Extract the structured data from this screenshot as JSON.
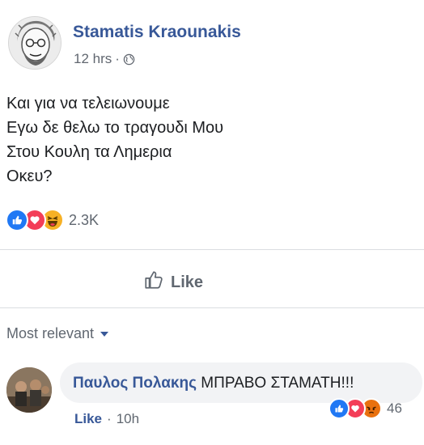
{
  "post": {
    "author": "Stamatis Kraounakis",
    "time": "12 hrs",
    "separator": "·",
    "privacy_icon": "globe-icon",
    "text_lines": [
      "Και για να τελειωνουμε",
      "Εγω δε θελω το τραγουδι Μου",
      "Στου Κουλη τα Λημερια",
      "Οκευ?"
    ],
    "reactions": {
      "icons": [
        "like-icon",
        "love-icon",
        "haha-icon"
      ],
      "count": "2.3K"
    },
    "actions": {
      "like_label": "Like"
    }
  },
  "comments_header": {
    "sort_label": "Most relevant"
  },
  "comment": {
    "author": "Παυλος Πολακης",
    "text": "ΜΠΡΑΒΟ ΣΤΑΜΑΤΗ!!!",
    "like_label": "Like",
    "separator": "·",
    "time": "10h",
    "reactions": {
      "icons": [
        "like-icon",
        "love-icon",
        "angry-icon"
      ],
      "count": "46"
    }
  },
  "colors": {
    "author_blue": "#385898",
    "like_blue": "#2078f4",
    "love_red": "#f33e58",
    "haha_yellow": "#f7b125",
    "angry_orange": "#e9710f",
    "secondary_text": "#606770",
    "divider": "#dadde1",
    "bubble": "#f2f3f5"
  }
}
